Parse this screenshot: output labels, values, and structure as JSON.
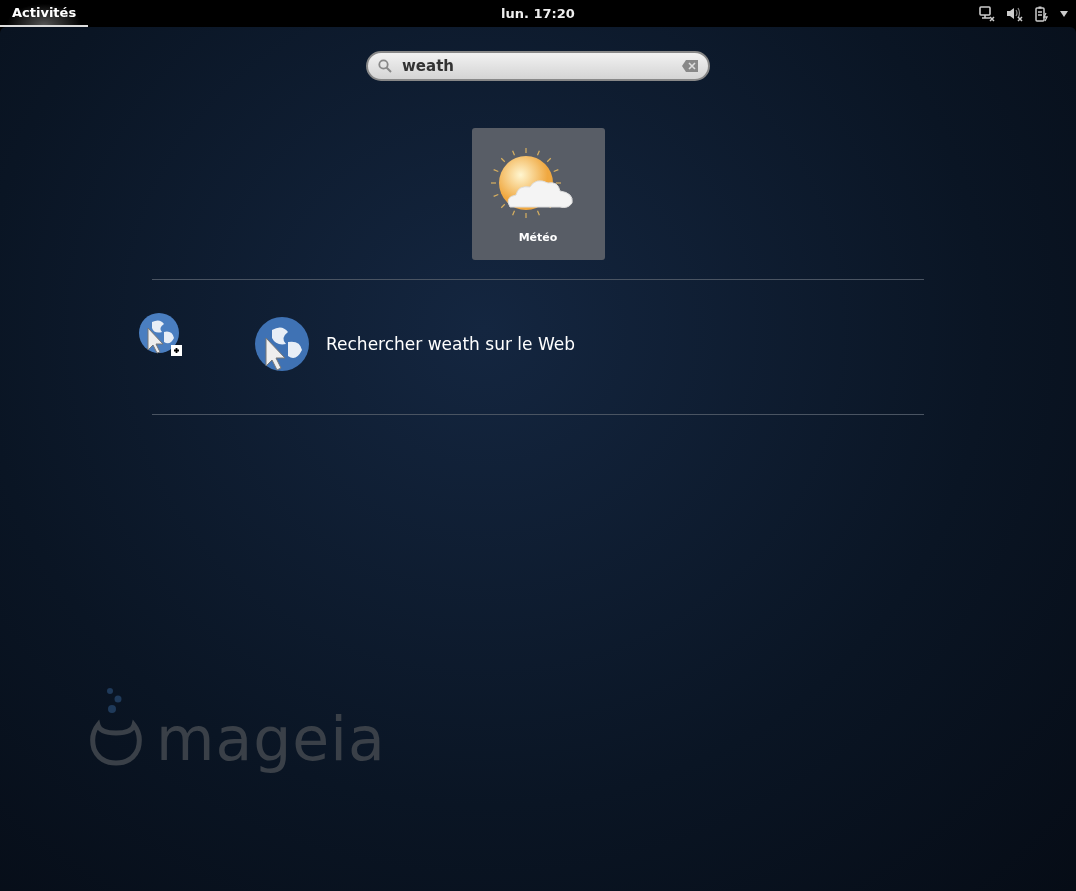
{
  "top_bar": {
    "activities": {
      "label": "Activités",
      "selected": true
    },
    "clock": "lun. 17:20"
  },
  "search": {
    "value": "weath"
  },
  "app_results": [
    {
      "name": "Météo",
      "selected": true
    }
  ],
  "web_search": {
    "label": "Rechercher weath sur le Web"
  },
  "wallpaper_logo": "mageia"
}
